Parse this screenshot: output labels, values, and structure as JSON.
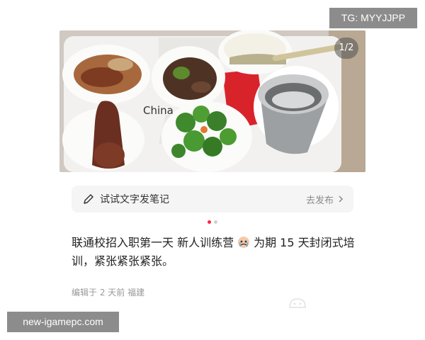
{
  "watermark_top": "TG: MYYJJPP",
  "watermark_bottom": "new-igamepc.com",
  "gallery": {
    "page_indicator": "1/2",
    "current_page": 1,
    "total_pages": 2
  },
  "note_bar": {
    "label": "试试文字发笔记",
    "action": "去发布",
    "icon": "pencil-icon",
    "action_icon": "chevron-right-icon"
  },
  "post": {
    "text_before_emoji": "联通校招入职第一天 新人训练营",
    "emoji": "crying-face-icon",
    "text_after_emoji": "为期 15 天封闭式培训，紧张紧张紧张。",
    "meta": "编辑于 2 天前 福建"
  },
  "colors": {
    "accent": "#ff2442",
    "muted": "#999999",
    "bar_bg": "#f5f5f5"
  }
}
